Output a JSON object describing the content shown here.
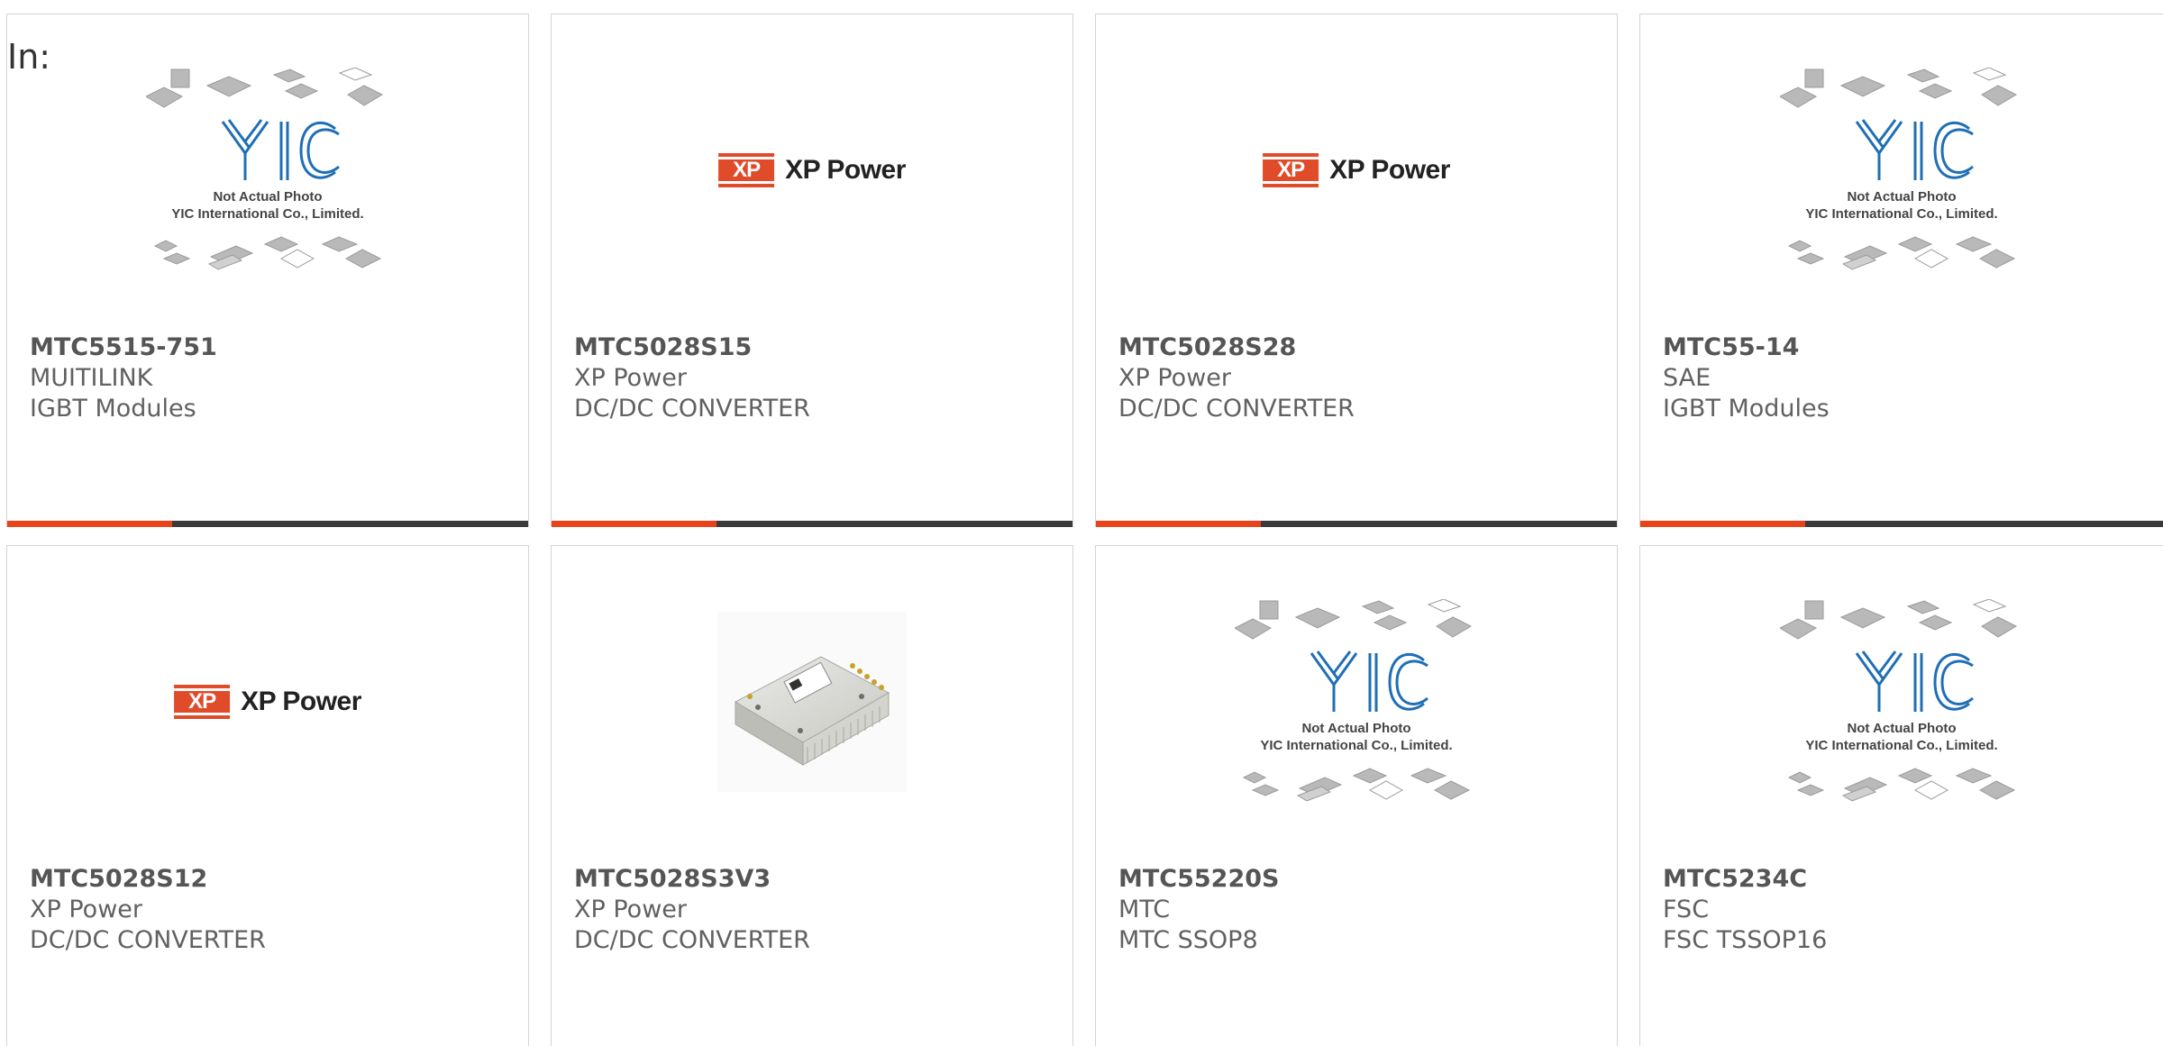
{
  "header": {
    "label": "In:"
  },
  "products": [
    {
      "part_number": "MTC5515-751",
      "manufacturer": "MUITILINK",
      "category": "IGBT Modules",
      "image": "yic-placeholder",
      "image_caption_1": "Not Actual Photo",
      "image_caption_2": "YIC International Co., Limited."
    },
    {
      "part_number": "MTC5028S15",
      "manufacturer": "XP Power",
      "category": "DC/DC CONVERTER",
      "image": "xp-power-logo",
      "logo_badge": "XP",
      "logo_text": "XP Power"
    },
    {
      "part_number": "MTC5028S28",
      "manufacturer": "XP Power",
      "category": "DC/DC CONVERTER",
      "image": "xp-power-logo",
      "logo_badge": "XP",
      "logo_text": "XP Power"
    },
    {
      "part_number": "MTC55-14",
      "manufacturer": "SAE",
      "category": "IGBT Modules",
      "image": "yic-placeholder",
      "image_caption_1": "Not Actual Photo",
      "image_caption_2": "YIC International Co., Limited."
    },
    {
      "part_number": "MTC5028S12",
      "manufacturer": "XP Power",
      "category": "DC/DC CONVERTER",
      "image": "xp-power-logo",
      "logo_badge": "XP",
      "logo_text": "XP Power"
    },
    {
      "part_number": "MTC5028S3V3",
      "manufacturer": "XP Power",
      "category": "DC/DC CONVERTER",
      "image": "module-photo"
    },
    {
      "part_number": "MTC55220S",
      "manufacturer": "MTC",
      "category": "MTC SSOP8",
      "image": "yic-placeholder",
      "image_caption_1": "Not Actual Photo",
      "image_caption_2": "YIC International Co., Limited."
    },
    {
      "part_number": "MTC5234C",
      "manufacturer": "FSC",
      "category": "FSC TSSOP16",
      "image": "yic-placeholder",
      "image_caption_1": "Not Actual Photo",
      "image_caption_2": "YIC International Co., Limited."
    }
  ],
  "colors": {
    "accent": "#e8431b",
    "bar_dark": "#3b3b3b",
    "border": "#d4d4d4",
    "text": "#616161",
    "yic_blue": "#1f6fb5",
    "xp_red": "#e04b2a"
  }
}
